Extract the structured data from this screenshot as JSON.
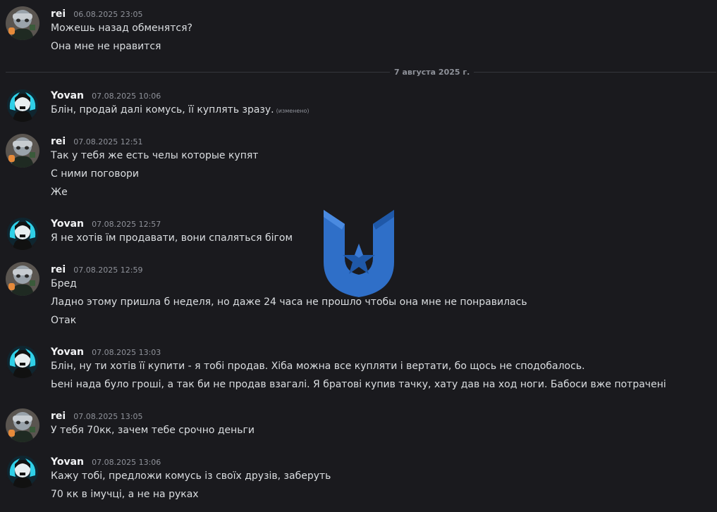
{
  "divider": {
    "label": "7 августа 2025 г."
  },
  "messages": [
    {
      "author": "rei",
      "time": "06.08.2025 23:05",
      "avatar": "rei-avatar",
      "lines": [
        "Можешь назад обменятся?",
        "Она мне не нравится"
      ]
    },
    {
      "author": "Yovan",
      "time": "07.08.2025 10:06",
      "avatar": "yovan-avatar",
      "lines": [
        "Блін, продай далі комусь, її куплять зразу."
      ],
      "edited": "(изменено)"
    },
    {
      "author": "rei",
      "time": "07.08.2025 12:51",
      "avatar": "rei-avatar",
      "lines": [
        "Так у тебя же есть челы которые купят",
        "С ними поговори",
        "Же"
      ]
    },
    {
      "author": "Yovan",
      "time": "07.08.2025 12:57",
      "avatar": "yovan-avatar",
      "lines": [
        "Я не хотів їм продавати, вони спаляться бігом"
      ]
    },
    {
      "author": "rei",
      "time": "07.08.2025 12:59",
      "avatar": "rei-avatar",
      "lines": [
        "Бред",
        "Ладно этому пришла б неделя, но даже 24 часа не прошло чтобы она мне не понравилась",
        "Отак"
      ]
    },
    {
      "author": "Yovan",
      "time": "07.08.2025 13:03",
      "avatar": "yovan-avatar",
      "lines": [
        "Блін, ну ти хотів її купити - я тобі продав. Хіба можна все купляти і вертати, бо щось не сподобалось.",
        "Ьені нада було гроші, а так би не продав взагалі. Я братові купив тачку, хату дав на ход ноги. Бабоси вже потрачені"
      ]
    },
    {
      "author": "rei",
      "time": "07.08.2025 13:05",
      "avatar": "rei-avatar",
      "lines": [
        "У тебя 70кк, зачем тебе срочно деньги"
      ]
    },
    {
      "author": "Yovan",
      "time": "07.08.2025 13:06",
      "avatar": "yovan-avatar",
      "lines": [
        "Кажу тобі, предложи комусь із своїх друзів, заберуть",
        "70 кк в імучці, а не на руках"
      ]
    }
  ],
  "watermark": {
    "icon": "shield-star-logo",
    "color": "#2f6fc8"
  }
}
